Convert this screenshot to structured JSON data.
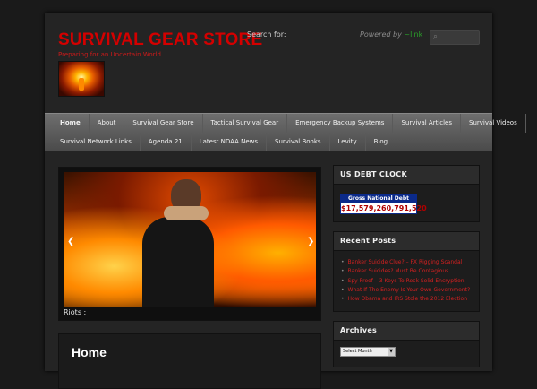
{
  "header": {
    "site_title": "SURVIVAL GEAR STORE",
    "tagline": "Preparing for an Uncertain World",
    "search_label": "Search for:",
    "powered_by": "Powered by",
    "powered_link": "~link"
  },
  "nav": {
    "row1": [
      "Home",
      "About",
      "Survival Gear Store",
      "Tactical Survival Gear",
      "Emergency Backup Systems",
      "Survival Articles",
      "Survival Videos"
    ],
    "row2": [
      "Survival Network Links",
      "Agenda 21",
      "Latest NDAA News",
      "Survival Books",
      "Levity",
      "Blog"
    ]
  },
  "slider": {
    "caption": "Riots :",
    "prev": "❮",
    "next": "❯"
  },
  "main": {
    "title": "Home"
  },
  "sidebar": {
    "debt": {
      "title": "US DEBT CLOCK",
      "label": "Gross National Debt",
      "value": "$17,579,260,791,520"
    },
    "recent": {
      "title": "Recent Posts",
      "items": [
        "Banker Suicide Clue? – FX Rigging Scandal",
        "Banker Suicides? Must Be Contagious",
        "Spy Proof – 3 Keys To Rock Solid Encryption",
        "What If The Enemy Is Your Own Government?",
        "How Obama and IRS Stole the 2012 Election"
      ]
    },
    "archives": {
      "title": "Archives",
      "select": "Select Month"
    }
  }
}
